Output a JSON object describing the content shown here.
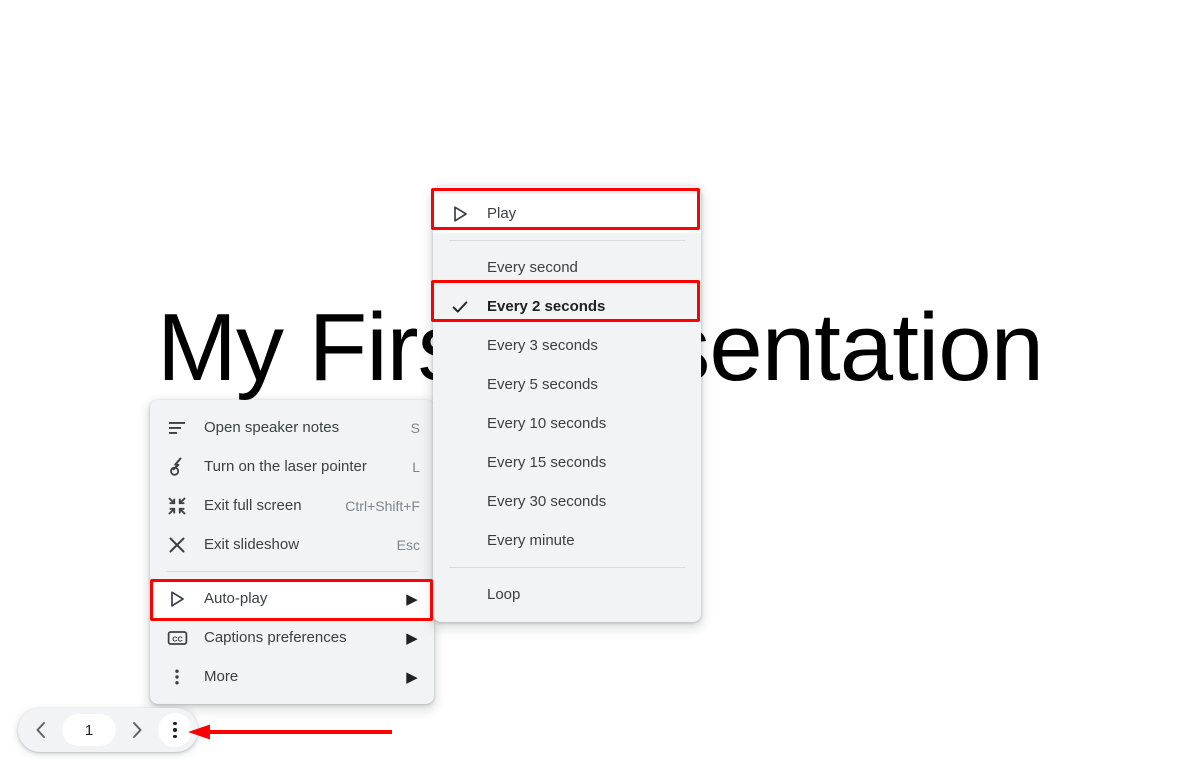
{
  "slide": {
    "title": "My First Presentation"
  },
  "context_menu": {
    "items": [
      {
        "label": "Open speaker notes",
        "accel": "S",
        "icon": "speaker-notes-icon",
        "caret": ""
      },
      {
        "label": "Turn on the laser pointer",
        "accel": "L",
        "icon": "laser-pointer-icon",
        "caret": ""
      },
      {
        "label": "Exit full screen",
        "accel": "Ctrl+Shift+F",
        "icon": "exit-fullscreen-icon",
        "caret": ""
      },
      {
        "label": "Exit slideshow",
        "accel": "Esc",
        "icon": "close-icon",
        "caret": ""
      },
      {
        "label": "Auto-play",
        "accel": "",
        "icon": "play-icon",
        "caret": "▶"
      },
      {
        "label": "Captions preferences",
        "accel": "",
        "icon": "closed-captions-icon",
        "caret": "▶"
      },
      {
        "label": "More",
        "accel": "",
        "icon": "more-vertical-icon",
        "caret": "▶"
      }
    ]
  },
  "autoplay_submenu": {
    "play": {
      "label": "Play",
      "icon": "play-icon"
    },
    "intervals": [
      {
        "label": "Every second",
        "checked": false
      },
      {
        "label": "Every 2 seconds",
        "checked": true
      },
      {
        "label": "Every 3 seconds",
        "checked": false
      },
      {
        "label": "Every 5 seconds",
        "checked": false
      },
      {
        "label": "Every 10 seconds",
        "checked": false
      },
      {
        "label": "Every 15 seconds",
        "checked": false
      },
      {
        "label": "Every 30 seconds",
        "checked": false
      },
      {
        "label": "Every minute",
        "checked": false
      }
    ],
    "loop": {
      "label": "Loop",
      "checked": false
    }
  },
  "toolbar": {
    "previous_label": "‹",
    "page_number": "1",
    "next_label": "›"
  },
  "annotations": {
    "color": "#ff0000",
    "boxes": [
      "play-item",
      "every-2-seconds-item",
      "auto-play-item"
    ],
    "arrow": "points-to-toolbar-more-button"
  }
}
